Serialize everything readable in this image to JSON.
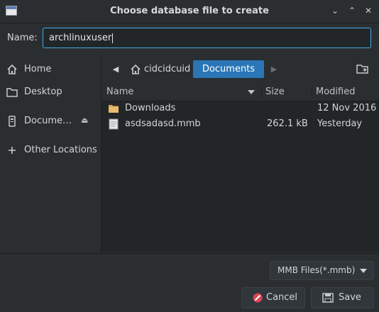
{
  "window": {
    "title": "Choose database file to create"
  },
  "name_field": {
    "label": "Name:",
    "value": "archlinuxuser"
  },
  "sidebar": {
    "items": [
      {
        "label": "Home",
        "icon": "home-icon"
      },
      {
        "label": "Desktop",
        "icon": "folder-icon"
      },
      {
        "label": "Docume…",
        "icon": "drive-icon"
      },
      {
        "label": "Other Locations",
        "icon": "plus-icon"
      }
    ]
  },
  "breadcrumb": {
    "home": "cidcidcuid",
    "current": "Documents"
  },
  "file_list": {
    "columns": {
      "name": "Name",
      "size": "Size",
      "modified": "Modified"
    },
    "rows": [
      {
        "name": "Downloads",
        "size": "",
        "modified": "12 Nov 2016",
        "icon": "folder-icon"
      },
      {
        "name": "asdsadasd.mmb",
        "size": "262.1 kB",
        "modified": "Yesterday",
        "icon": "file-icon"
      }
    ]
  },
  "filter": {
    "value": "MMB Files(*.mmb)"
  },
  "buttons": {
    "cancel": "Cancel",
    "save": "Save"
  },
  "colors": {
    "accent": "#2a76b6",
    "focus": "#3daee9",
    "background": "#2b2e31"
  }
}
